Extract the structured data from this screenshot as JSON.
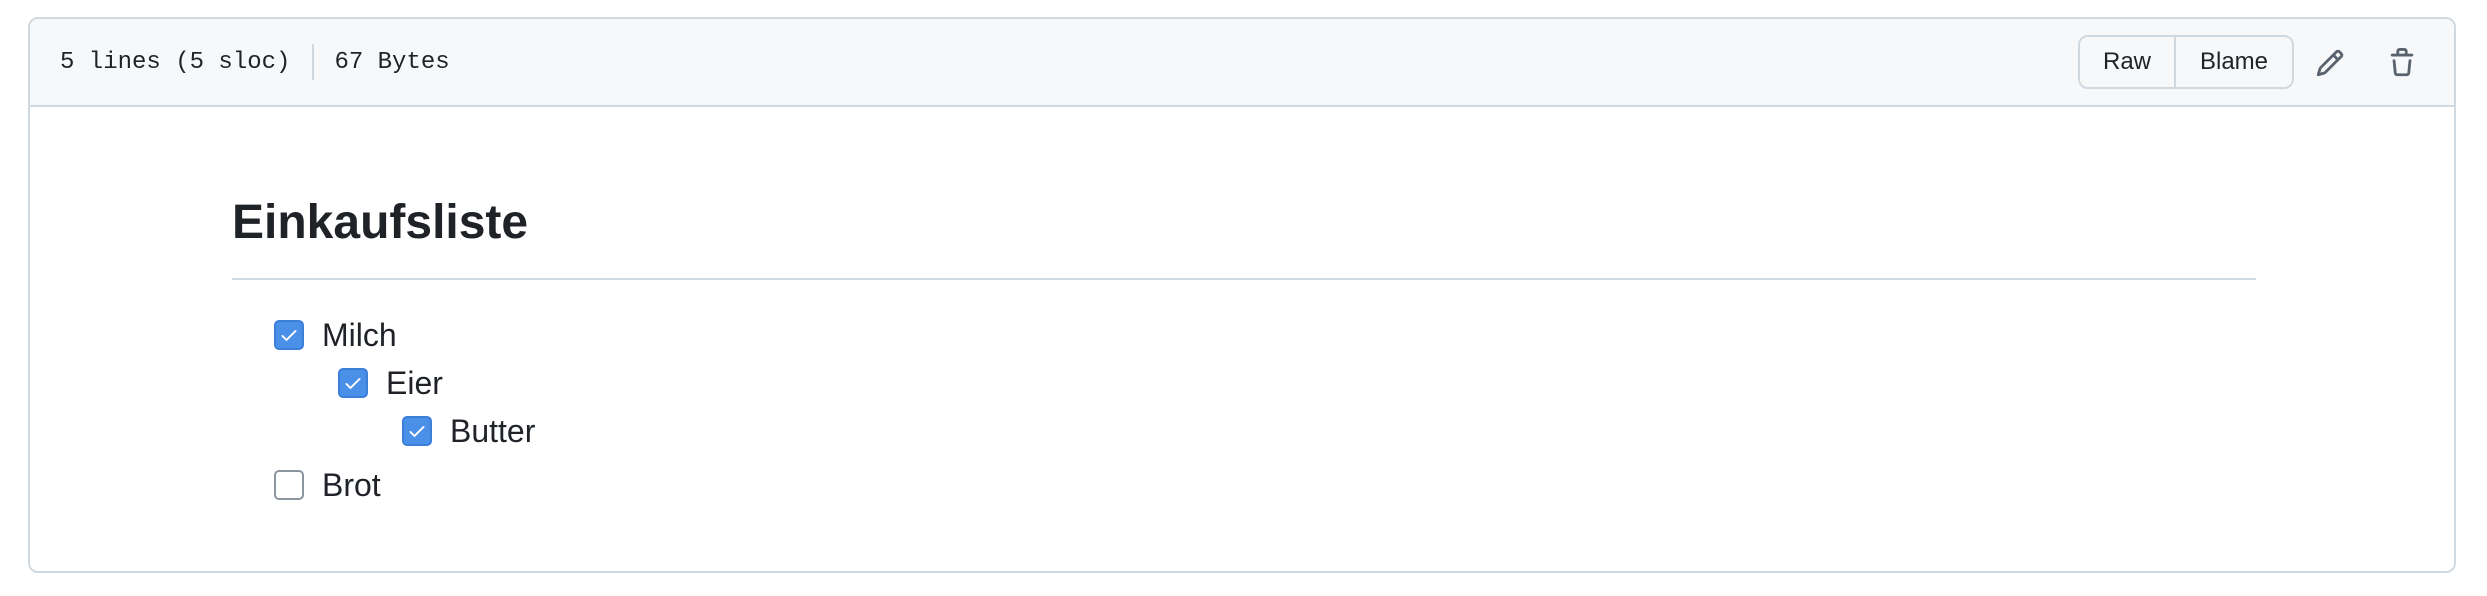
{
  "header": {
    "lines": "5 lines (5 sloc)",
    "size": "67 Bytes",
    "raw_label": "Raw",
    "blame_label": "Blame",
    "edit_icon": "pencil-icon",
    "delete_icon": "trash-icon"
  },
  "document": {
    "title": "Einkaufsliste",
    "tasks": [
      {
        "label": "Milch",
        "checked": true,
        "level": 0
      },
      {
        "label": "Eier",
        "checked": true,
        "level": 1
      },
      {
        "label": "Butter",
        "checked": true,
        "level": 2
      },
      {
        "label": "Brot",
        "checked": false,
        "level": 0
      }
    ]
  },
  "colors": {
    "checkbox_checked": "#4a8fe8",
    "border": "#d1d9e0",
    "header_bg": "#f6f8fa",
    "text": "#1f2328"
  }
}
